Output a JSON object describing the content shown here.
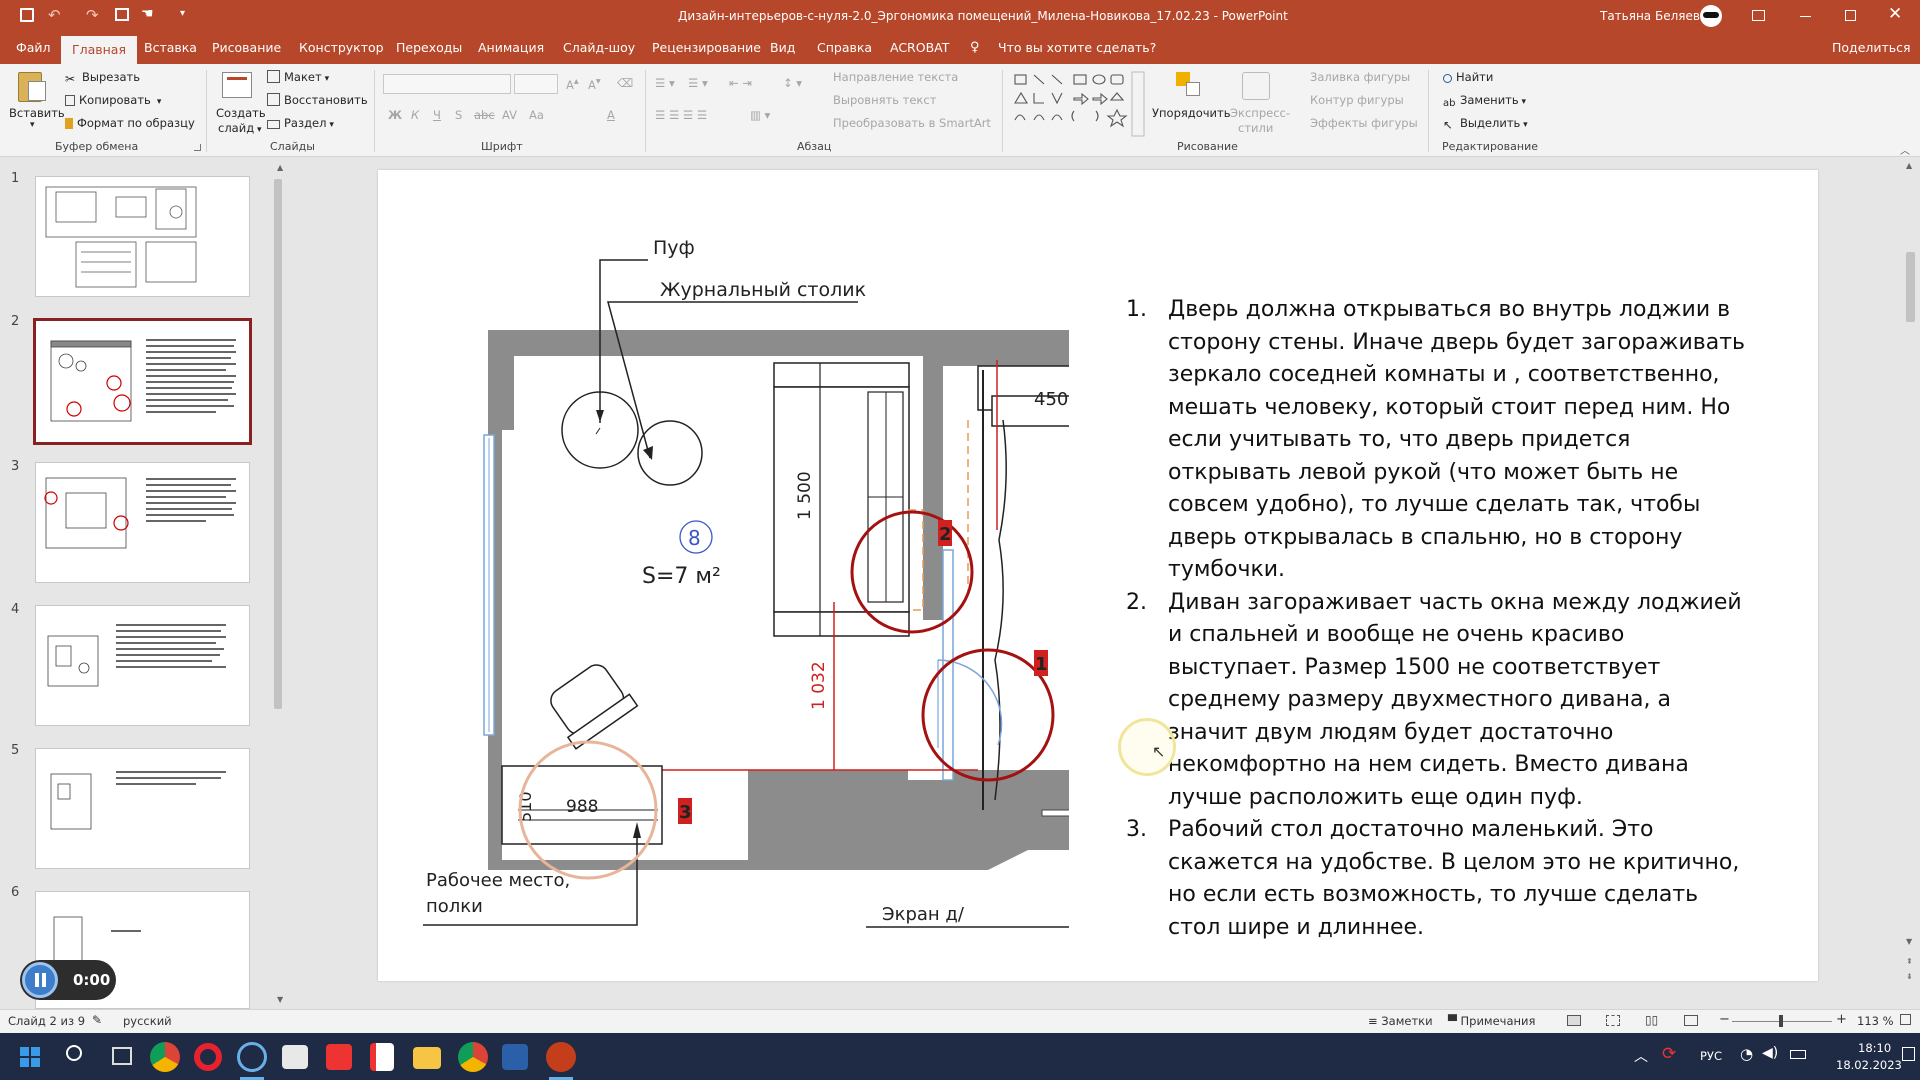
{
  "window": {
    "title": "Дизайн-интерьеров-с-нуля-2.0_Эргономика помещений_Милена-Новикова_17.02.23 - PowerPoint",
    "user": "Татьяна Беляева"
  },
  "tabs": [
    "Файл",
    "Главная",
    "Вставка",
    "Рисование",
    "Конструктор",
    "Переходы",
    "Анимация",
    "Слайд-шоу",
    "Рецензирование",
    "Вид",
    "Справка",
    "ACROBAT"
  ],
  "active_tab": "Главная",
  "tell_me": "Что вы хотите сделать?",
  "share": "Поделиться",
  "ribbon": {
    "clipboard": {
      "paste": "Вставить",
      "cut": "Вырезать",
      "copy": "Копировать",
      "format": "Формат по образцу",
      "label": "Буфер обмена"
    },
    "slides": {
      "new": "Создать",
      "new2": "слайд",
      "layout": "Макет",
      "reset": "Восстановить",
      "section": "Раздел",
      "label": "Слайды"
    },
    "font": {
      "label": "Шрифт",
      "bold": "Ж",
      "italic": "К",
      "underline": "Ч",
      "strike": "S",
      "aa": "Aa"
    },
    "paragraph": {
      "dir": "Направление текста",
      "align": "Выровнять текст",
      "smartart": "Преобразовать в SmartArt",
      "label": "Абзац"
    },
    "drawing": {
      "arrange": "Упорядочить",
      "styles1": "Экспресс-",
      "styles2": "стили",
      "fill": "Заливка фигуры",
      "outline": "Контур фигуры",
      "effects": "Эффекты фигуры",
      "label": "Рисование"
    },
    "editing": {
      "find": "Найти",
      "replace": "Заменить",
      "select": "Выделить",
      "label": "Редактирование"
    }
  },
  "thumbnails": [
    "1",
    "2",
    "3",
    "4",
    "5",
    "6"
  ],
  "selected_slide": "2",
  "plan": {
    "puf": "Пуф",
    "table": "Журнальный столик",
    "room_num": "8",
    "area": "S=7 м²",
    "dim_450": "450",
    "dim_1500": "1 500",
    "dim_1032": "1 032",
    "dim_510": "510",
    "dim_988": "988",
    "workplace1": "Рабочее место,",
    "workplace2": "полки",
    "screen": "Экран д/",
    "mark1": "1",
    "mark2": "2",
    "mark3": "3"
  },
  "slide_text": [
    {
      "num": "1.",
      "text": "Дверь должна открываться во внутрь лоджии в сторону стены. Иначе дверь будет загораживать зеркало соседней комнаты и , соответственно, мешать человеку, который стоит перед ним. Но если учитывать то, что дверь придется открывать левой рукой (что может быть не совсем удобно), то лучше сделать так, чтобы дверь открывалась в спальню, но в сторону тумбочки."
    },
    {
      "num": "2.",
      "text": "Диван загораживает часть окна между лоджией и спальней и вообще не очень красиво выступает. Размер 1500 не соответствует среднему размеру двухместного дивана, а значит двум людям будет достаточно некомфортно на нем сидеть. Вместо дивана лучше расположить еще один пуф."
    },
    {
      "num": "3.",
      "text": "Рабочий стол достаточно маленький. Это скажется на удобстве. В целом это не критично, но если есть возможность, то лучше сделать стол шире и длиннее."
    }
  ],
  "recording": {
    "time": "0:00"
  },
  "status": {
    "slide": "Слайд 2 из 9",
    "lang": "русский",
    "notes": "Заметки",
    "comments": "Примечания",
    "zoom": "113 %"
  },
  "tray": {
    "lang": "РУС",
    "time": "18:10",
    "date": "18.02.2023"
  },
  "colors": {
    "brand": "#b7472a",
    "red_mark": "#c00000",
    "taskbar": "#1f2a44"
  }
}
